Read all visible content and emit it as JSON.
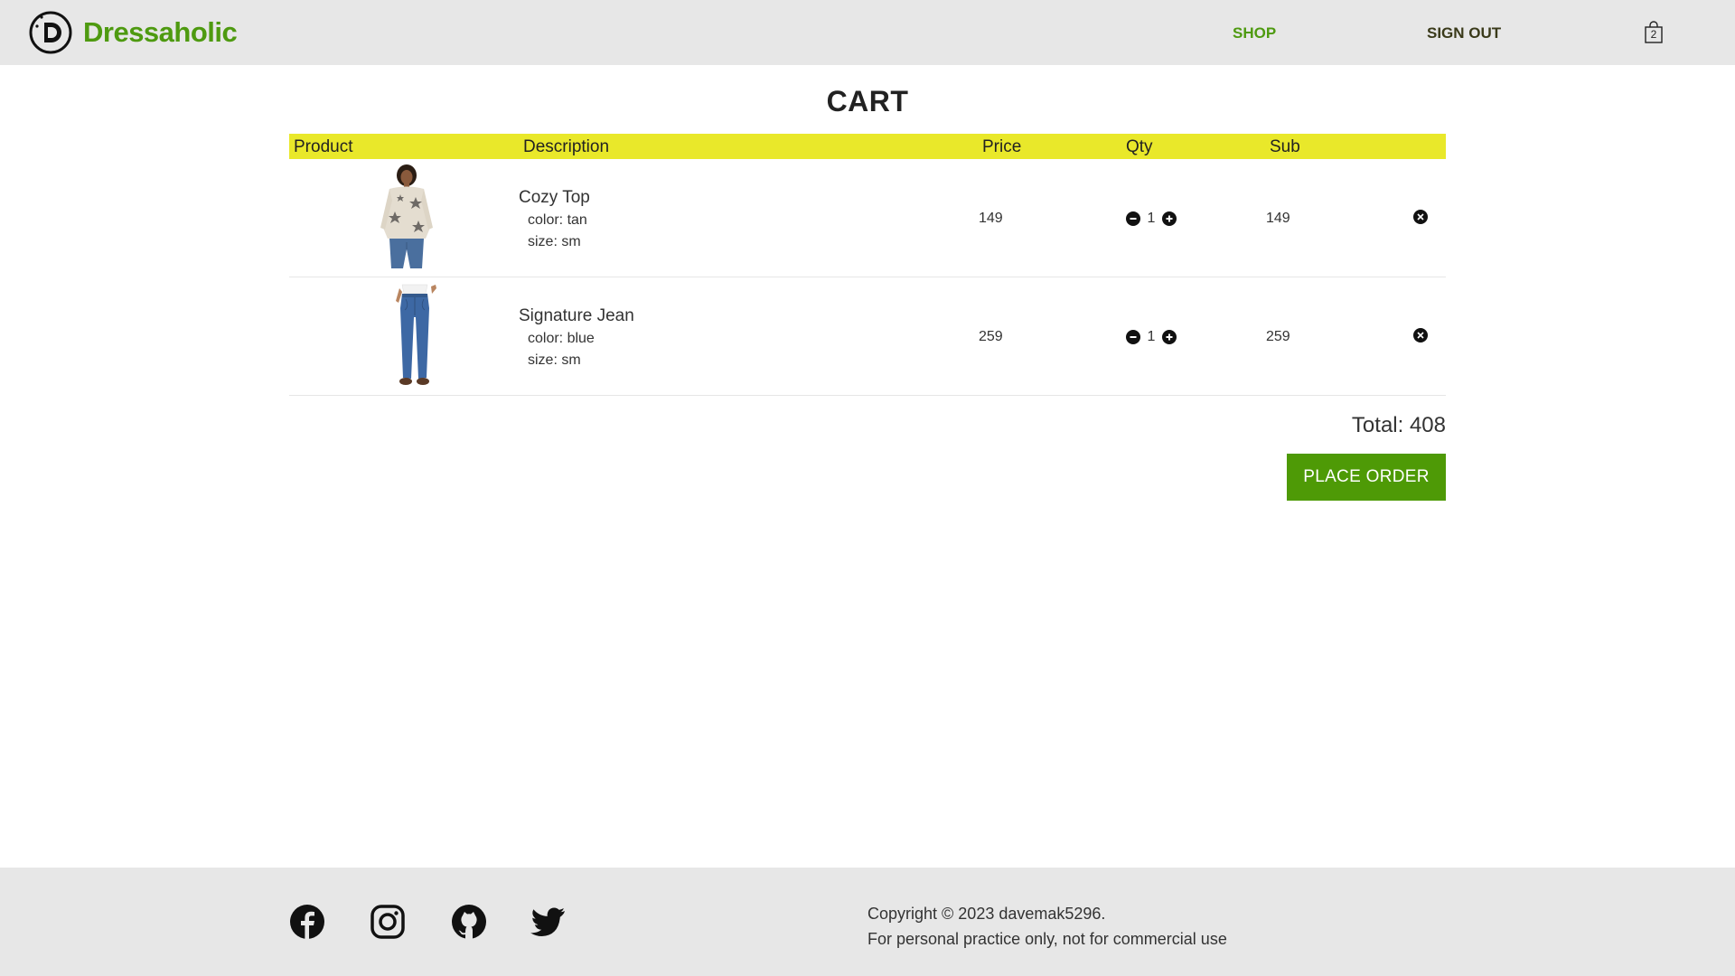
{
  "header": {
    "brand": "Dressaholic",
    "nav": {
      "shop": "SHOP",
      "sign_out": "SIGN OUT"
    },
    "cart_count": "2"
  },
  "cart": {
    "title": "CART",
    "columns": {
      "product": "Product",
      "description": "Description",
      "price": "Price",
      "qty": "Qty",
      "sub": "Sub"
    },
    "items": [
      {
        "name": "Cozy Top",
        "color": "color: tan",
        "size": "size: sm",
        "price": "149",
        "qty": "1",
        "sub": "149"
      },
      {
        "name": "Signature Jean",
        "color": "color: blue",
        "size": "size: sm",
        "price": "259",
        "qty": "1",
        "sub": "259"
      }
    ],
    "total": "Total: 408",
    "place_order": "PLACE ORDER"
  },
  "footer": {
    "copyright": "Copyright © 2023 davemak5296.",
    "disclaimer": "For personal practice only, not for commercial use"
  },
  "colors": {
    "brand_green": "#4e9a10",
    "header_bg": "#e7e7e7",
    "table_head_bg": "#e9e82a",
    "button_green": "#4e9a06"
  },
  "icons": {
    "logo": "d-logo-icon",
    "cart": "shopping-bag-icon",
    "qty_decrease": "minus-circle-icon",
    "qty_increase": "plus-circle-icon",
    "remove": "x-circle-icon",
    "social": [
      "facebook-icon",
      "instagram-icon",
      "github-icon",
      "twitter-icon"
    ]
  }
}
